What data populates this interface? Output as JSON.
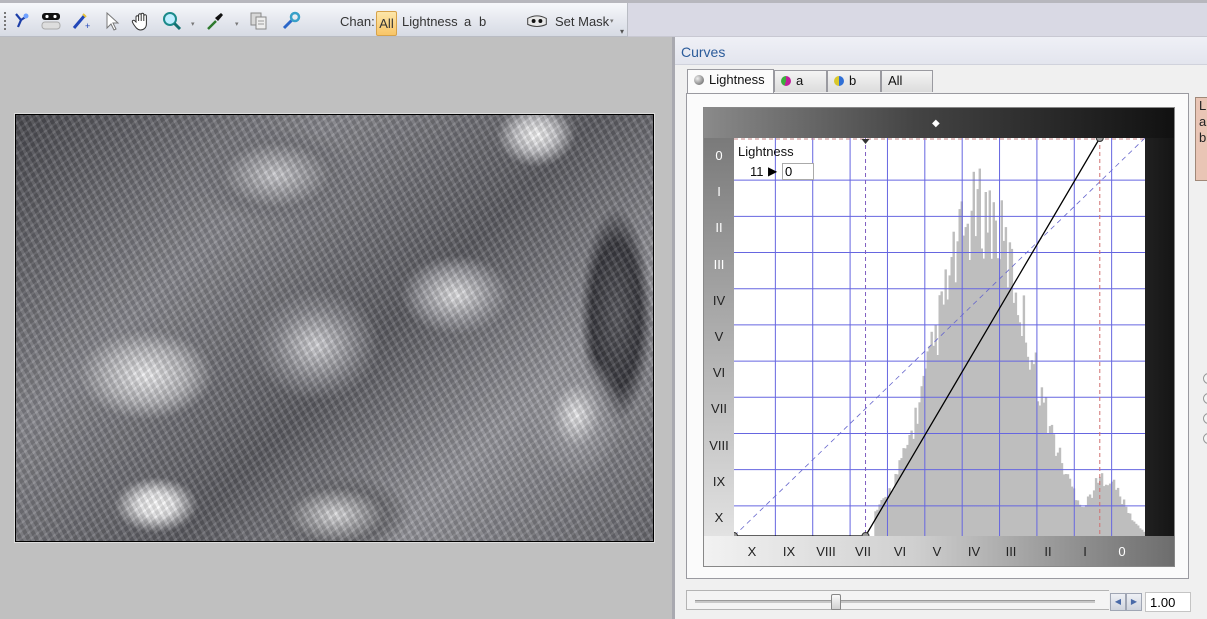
{
  "toolbar": {
    "tools": [
      {
        "name": "adjust-tool-icon",
        "tooltip": ""
      },
      {
        "name": "mask-tool-icon",
        "tooltip": ""
      },
      {
        "name": "magic-brush-icon",
        "tooltip": ""
      },
      {
        "name": "pointer-icon",
        "tooltip": ""
      },
      {
        "name": "hand-icon",
        "tooltip": ""
      },
      {
        "name": "zoom-icon",
        "tooltip": ""
      },
      {
        "name": "eyedropper-icon",
        "tooltip": ""
      },
      {
        "name": "copy-icon",
        "tooltip": ""
      },
      {
        "name": "wrench-icon",
        "tooltip": ""
      }
    ],
    "chan_label": "Chan:",
    "channels": [
      "All",
      "Lightness",
      "a",
      "b"
    ],
    "active_channel": "All",
    "set_mask_label": "Set Mask"
  },
  "panel": {
    "title": "Curves",
    "tabs": [
      {
        "label": "Lightness",
        "icon": "lightness-ball-icon",
        "active": true
      },
      {
        "label": "a",
        "icon": "a-channel-icon",
        "active": false
      },
      {
        "label": "b",
        "icon": "b-channel-icon",
        "active": false
      },
      {
        "label": "All",
        "icon": "",
        "active": false
      }
    ],
    "curve": {
      "channel_title": "Lightness",
      "input_value": "11",
      "output_value": "0",
      "y_zone_labels": [
        "0",
        "I",
        "II",
        "III",
        "IV",
        "V",
        "VI",
        "VII",
        "VIII",
        "IX",
        "X"
      ],
      "x_zone_labels": [
        "X",
        "IX",
        "VIII",
        "VII",
        "VI",
        "V",
        "IV",
        "III",
        "II",
        "I",
        "0"
      ],
      "control_points": [
        {
          "input": 0,
          "output": 0
        },
        {
          "input": 32,
          "output": 0
        },
        {
          "input": 89,
          "output": 100
        }
      ],
      "black_point": 32,
      "white_point": 89,
      "grid_color": "#6666e0",
      "curve_color": "#000000",
      "histogram_color": "#bebebe"
    },
    "gamma_slider": 0.34,
    "gamma_value": "1.00",
    "side_box_lines": [
      "L",
      "a",
      "b"
    ]
  }
}
